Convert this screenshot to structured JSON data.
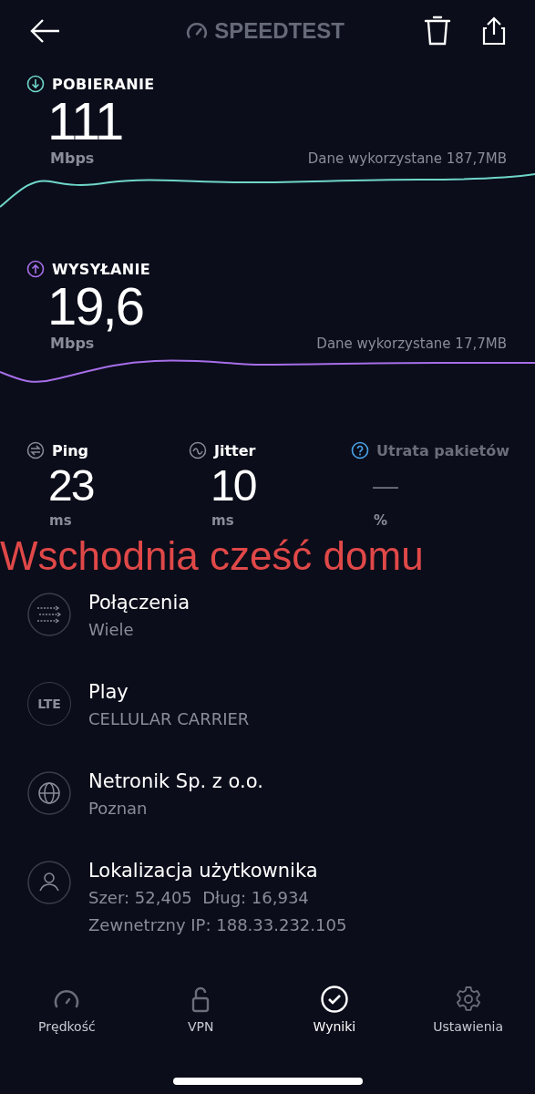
{
  "header": {
    "logo": "SPEEDTEST"
  },
  "speeds": [
    {
      "kind": "download",
      "label": "POBIERANIE",
      "value": "111",
      "unit": "Mbps",
      "data_used": "Dane wykorzystane 187,7MB",
      "color": "#6fd6c9"
    },
    {
      "kind": "upload",
      "label": "WYSYŁANIE",
      "value": "19,6",
      "unit": "Mbps",
      "data_used": "Dane wykorzystane 17,7MB",
      "color": "#a66ee8"
    }
  ],
  "stats": [
    {
      "kind": "ping",
      "label": "Ping",
      "value": "23",
      "unit": "ms",
      "disabled": false
    },
    {
      "kind": "jitter",
      "label": "Jitter",
      "value": "10",
      "unit": "ms",
      "disabled": false
    },
    {
      "kind": "loss",
      "label": "Utrata pakietów",
      "value": "—",
      "unit": "%",
      "disabled": true
    }
  ],
  "annotation": "Wschodnia cześć domu",
  "info": [
    {
      "kind": "connections",
      "title": "Połączenia",
      "lines": [
        "Wiele"
      ]
    },
    {
      "kind": "lte",
      "icon_text": "LTE",
      "title": "Play",
      "lines": [
        "CELLULAR CARRIER"
      ]
    },
    {
      "kind": "globe",
      "title": "Netronik Sp. z o.o.",
      "lines": [
        "Poznan"
      ]
    },
    {
      "kind": "user",
      "title": "Lokalizacja użytkownika",
      "lines": [
        "Szer: 52,405  Dług: 16,934",
        "Zewnetrzny IP: 188.33.232.105"
      ]
    }
  ],
  "tabs": [
    {
      "kind": "speed",
      "label": "Prędkość",
      "selected": false
    },
    {
      "kind": "vpn",
      "label": "VPN",
      "selected": false
    },
    {
      "kind": "results",
      "label": "Wyniki",
      "selected": true
    },
    {
      "kind": "settings",
      "label": "Ustawienia",
      "selected": false
    }
  ]
}
